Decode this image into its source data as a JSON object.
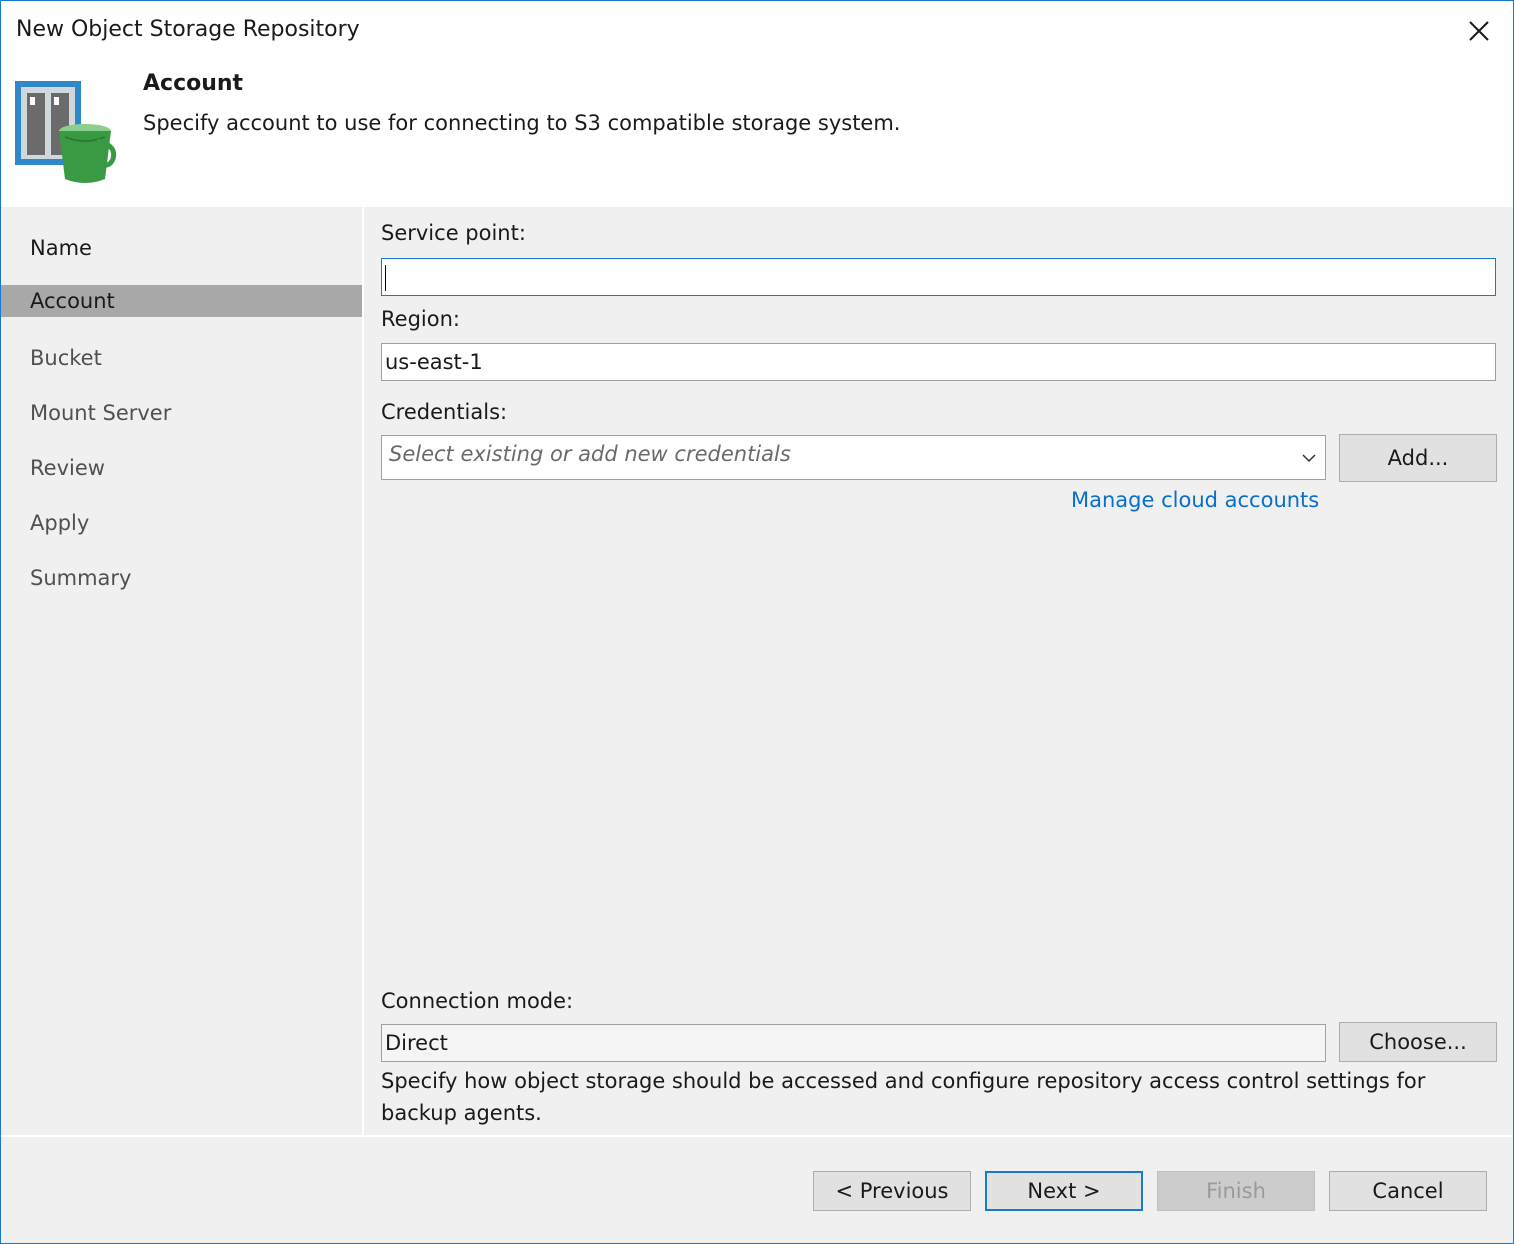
{
  "window": {
    "title": "New Object Storage Repository"
  },
  "header": {
    "title": "Account",
    "description": "Specify account to use for connecting to S3 compatible storage system."
  },
  "steps": [
    {
      "label": "Name",
      "state": "done"
    },
    {
      "label": "Account",
      "state": "active"
    },
    {
      "label": "Bucket",
      "state": "pending"
    },
    {
      "label": "Mount Server",
      "state": "pending"
    },
    {
      "label": "Review",
      "state": "pending"
    },
    {
      "label": "Apply",
      "state": "pending"
    },
    {
      "label": "Summary",
      "state": "pending"
    }
  ],
  "form": {
    "service_point": {
      "label": "Service point:",
      "value": ""
    },
    "region": {
      "label": "Region:",
      "value": "us-east-1"
    },
    "credentials": {
      "label": "Credentials:",
      "placeholder": "Select existing or add new credentials",
      "add_button": "Add...",
      "manage_link": "Manage cloud accounts"
    },
    "connection_mode": {
      "label": "Connection mode:",
      "value": "Direct",
      "choose_button": "Choose...",
      "hint": "Specify how object storage should be accessed and configure repository access control settings for backup agents."
    }
  },
  "footer": {
    "previous": "< Previous",
    "next": "Next >",
    "finish": "Finish",
    "cancel": "Cancel"
  },
  "colors": {
    "accent": "#1979ca",
    "link": "#0a6fc9",
    "active_step": "#a8a8a8",
    "bucket_green": "#3a9a44"
  },
  "icons": {
    "close": "close-icon",
    "repository": "object-storage-bucket-icon",
    "dropdown": "chevron-down-icon"
  }
}
